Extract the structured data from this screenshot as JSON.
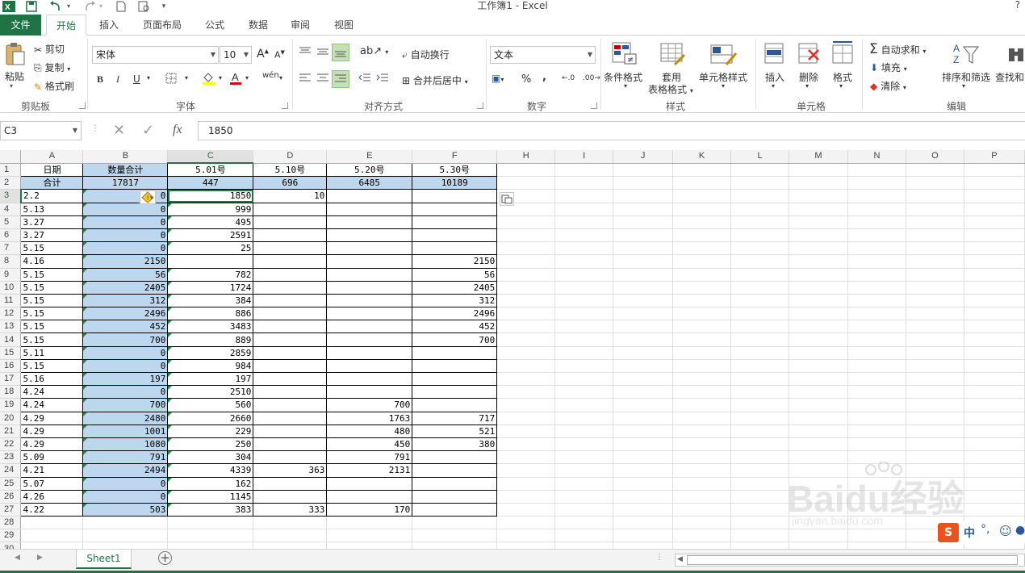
{
  "window": {
    "title": "工作簿1 - Excel",
    "help": "?"
  },
  "tabs": [
    {
      "label": "文件"
    },
    {
      "label": "开始"
    },
    {
      "label": "插入"
    },
    {
      "label": "页面布局"
    },
    {
      "label": "公式"
    },
    {
      "label": "数据"
    },
    {
      "label": "审阅"
    },
    {
      "label": "视图"
    }
  ],
  "ribbon": {
    "clipboard": {
      "paste": "粘贴",
      "cut": "剪切",
      "copy": "复制",
      "format_painter": "格式刷",
      "group": "剪贴板"
    },
    "font": {
      "name": "宋体",
      "size": "10",
      "bold": "B",
      "italic": "I",
      "underline": "U",
      "group": "字体",
      "grow": "A",
      "shrink": "A",
      "phonetic": "wén"
    },
    "alignment": {
      "wrap": "自动换行",
      "merge": "合并后居中",
      "group": "对齐方式"
    },
    "number": {
      "format": "文本",
      "percent": "%",
      "comma": ",",
      "inc": "←.0",
      "dec": ".00→",
      "group": "数字"
    },
    "styles": {
      "conditional": "条件格式",
      "table_l1": "套用",
      "table_l2": "表格格式",
      "cell_styles": "单元格样式",
      "group": "样式"
    },
    "cells": {
      "insert": "插入",
      "delete": "删除",
      "format": "格式",
      "group": "单元格"
    },
    "editing": {
      "autosum": "自动求和",
      "fill": "填充",
      "clear": "清除",
      "sort": "排序和筛选",
      "find": "查找和",
      "group": "编辑"
    }
  },
  "formula_bar": {
    "name_box": "C3",
    "fx": "fx",
    "value": "1850"
  },
  "sheet": {
    "columns": [
      "A",
      "B",
      "C",
      "D",
      "E",
      "F",
      "H",
      "I",
      "J",
      "K",
      "L",
      "M",
      "N",
      "O",
      "P"
    ],
    "rows": [
      [
        "日期",
        "数量合计",
        "5.01号",
        "5.10号",
        "5.20号",
        "5.30号"
      ],
      [
        "合计",
        "17817",
        "447",
        "696",
        "6485",
        "10189"
      ],
      [
        "2.2",
        "0",
        "1850",
        "10",
        "",
        ""
      ],
      [
        "5.13",
        "0",
        "999",
        "",
        "",
        ""
      ],
      [
        "3.27",
        "0",
        "495",
        "",
        "",
        ""
      ],
      [
        "3.27",
        "0",
        "2591",
        "",
        "",
        ""
      ],
      [
        "5.15",
        "0",
        "25",
        "",
        "",
        ""
      ],
      [
        "4.16",
        "2150",
        "",
        "",
        "",
        "2150"
      ],
      [
        "5.15",
        "56",
        "782",
        "",
        "",
        "56"
      ],
      [
        "5.15",
        "2405",
        "1724",
        "",
        "",
        "2405"
      ],
      [
        "5.15",
        "312",
        "384",
        "",
        "",
        "312"
      ],
      [
        "5.15",
        "2496",
        "886",
        "",
        "",
        "2496"
      ],
      [
        "5.15",
        "452",
        "3483",
        "",
        "",
        "452"
      ],
      [
        "5.15",
        "700",
        "889",
        "",
        "",
        "700"
      ],
      [
        "5.11",
        "0",
        "2859",
        "",
        "",
        ""
      ],
      [
        "5.15",
        "0",
        "984",
        "",
        "",
        ""
      ],
      [
        "5.16",
        "197",
        "197",
        "",
        "",
        ""
      ],
      [
        "4.24",
        "0",
        "2510",
        "",
        "",
        ""
      ],
      [
        "4.24",
        "700",
        "560",
        "",
        "700",
        ""
      ],
      [
        "4.29",
        "2480",
        "2660",
        "",
        "1763",
        "717"
      ],
      [
        "4.29",
        "1001",
        "229",
        "",
        "480",
        "521"
      ],
      [
        "4.29",
        "1080",
        "250",
        "",
        "450",
        "380"
      ],
      [
        "5.09",
        "791",
        "304",
        "",
        "791",
        ""
      ],
      [
        "4.21",
        "2494",
        "4339",
        "363",
        "2131",
        ""
      ],
      [
        "5.07",
        "0",
        "162",
        "",
        "",
        ""
      ],
      [
        "4.26",
        "0",
        "1145",
        "",
        "",
        ""
      ],
      [
        "4.22",
        "503",
        "383",
        "333",
        "170",
        ""
      ],
      [
        "",
        "",
        "",
        "",
        "",
        ""
      ],
      [
        "",
        "",
        "",
        "",
        "",
        ""
      ],
      [
        "",
        "",
        "",
        "",
        "",
        ""
      ]
    ]
  },
  "sheet_tabs": [
    {
      "label": "Sheet1"
    }
  ],
  "ime": {
    "lang": "中"
  },
  "watermark": {
    "brand": "Baidu经验",
    "url": "jingyan.baidu.com"
  },
  "colors": {
    "accent": "#217346",
    "highlight": "#bdd7ee"
  }
}
